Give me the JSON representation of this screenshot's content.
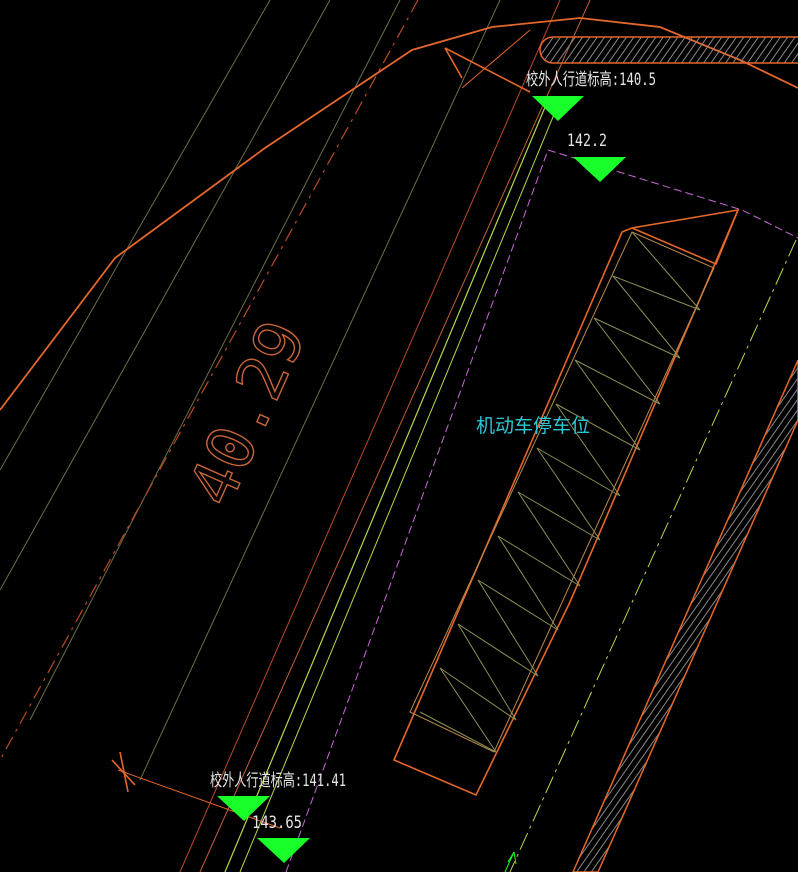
{
  "drawing": {
    "background": "#000000",
    "colors": {
      "boundary": "#e4672b",
      "thin_line": "#8f8f55",
      "road_line": "#b6d84e",
      "magenta_line": "#c76ad6",
      "marker": "#19ff2a",
      "zone_text": "#2bc7d4",
      "hatch": "#9a9a9a"
    },
    "dimension_text": "40.29",
    "zone_label": "机动车停车位",
    "elevation_markers": [
      {
        "label": "校外人行道标高:140.5"
      },
      {
        "label": "142.2"
      },
      {
        "label": "校外人行道标高:141.41"
      },
      {
        "label": "143.65"
      }
    ]
  }
}
